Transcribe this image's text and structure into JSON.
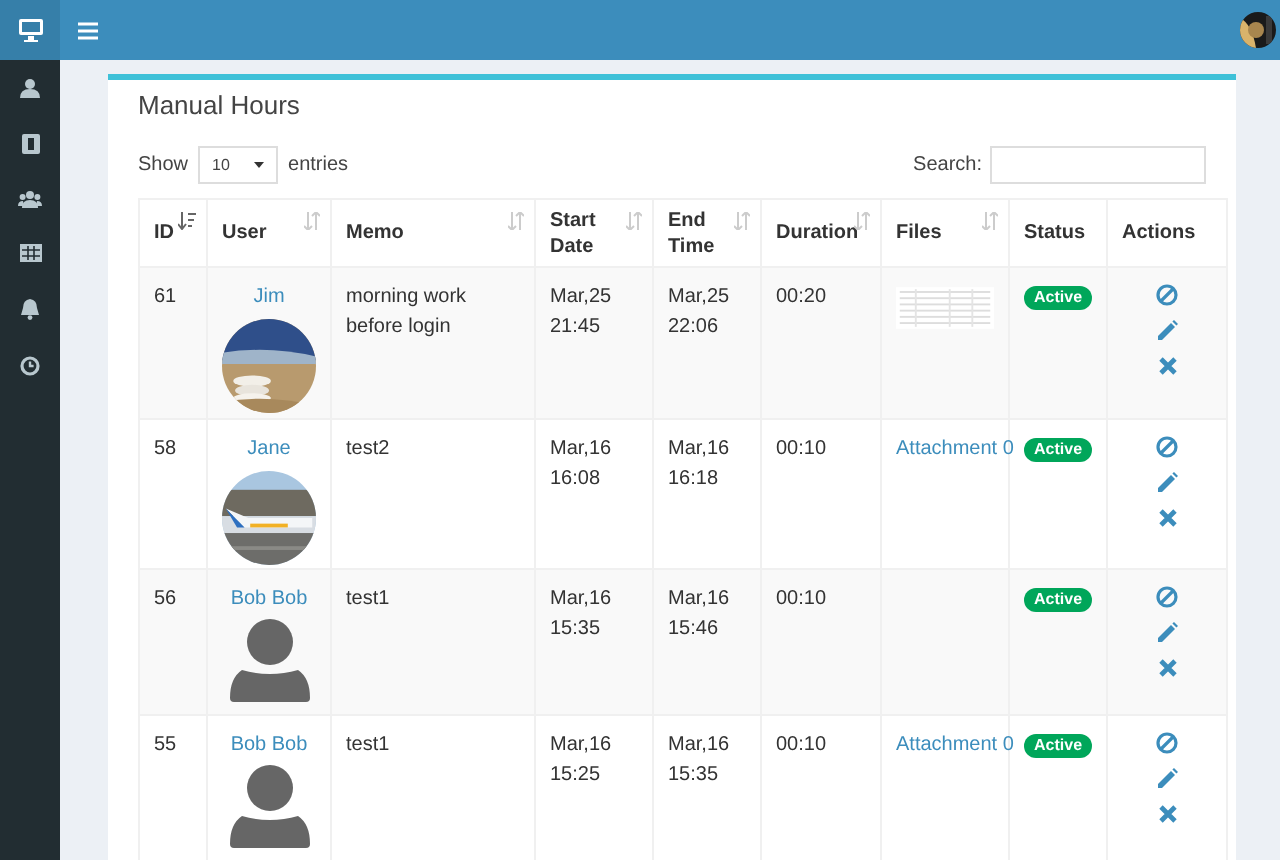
{
  "page_title": "Manual Hours",
  "length_menu": {
    "before": "Show",
    "value": "10",
    "after": "entries"
  },
  "search": {
    "label": "Search:"
  },
  "columns": [
    {
      "label": "ID",
      "kind": "sorted"
    },
    {
      "label": "User",
      "kind": "sortable"
    },
    {
      "label": "Memo",
      "kind": "sortable"
    },
    {
      "label": "Start Date",
      "kind": "sortable"
    },
    {
      "label": "End Time",
      "kind": "sortable"
    },
    {
      "label": "Duration",
      "kind": "sortable"
    },
    {
      "label": "Files",
      "kind": "sortable"
    },
    {
      "label": "Status",
      "kind": "plain"
    },
    {
      "label": "Actions",
      "kind": "plain"
    }
  ],
  "rows": [
    {
      "id": "61",
      "user": "Jim",
      "memo": "morning work before login",
      "start": [
        "Mar,25",
        "21:45"
      ],
      "end": [
        "Mar,25",
        "22:06"
      ],
      "duration": "00:20",
      "file": {
        "kind": "thumbnail"
      },
      "status": "Active"
    },
    {
      "id": "58",
      "user": "Jane",
      "memo": "test2",
      "start": [
        "Mar,16",
        "16:08"
      ],
      "end": [
        "Mar,16",
        "16:18"
      ],
      "duration": "00:10",
      "file": {
        "kind": "link",
        "text": "Attachment 0"
      },
      "status": "Active"
    },
    {
      "id": "56",
      "user": "Bob Bob",
      "avatar": {
        "kind": "default"
      },
      "memo": "test1",
      "start": [
        "Mar,16",
        "15:35"
      ],
      "end": [
        "Mar,16",
        "15:46"
      ],
      "duration": "00:10",
      "file": {
        "kind": "none"
      },
      "status": "Active"
    },
    {
      "id": "55",
      "user": "Bob Bob",
      "avatar": {
        "kind": "default"
      },
      "memo": "test1",
      "start": [
        "Mar,16",
        "15:25"
      ],
      "end": [
        "Mar,16",
        "15:35"
      ],
      "duration": "00:10",
      "file": {
        "kind": "link",
        "text": "Attachment 0"
      },
      "status": "Active"
    }
  ]
}
